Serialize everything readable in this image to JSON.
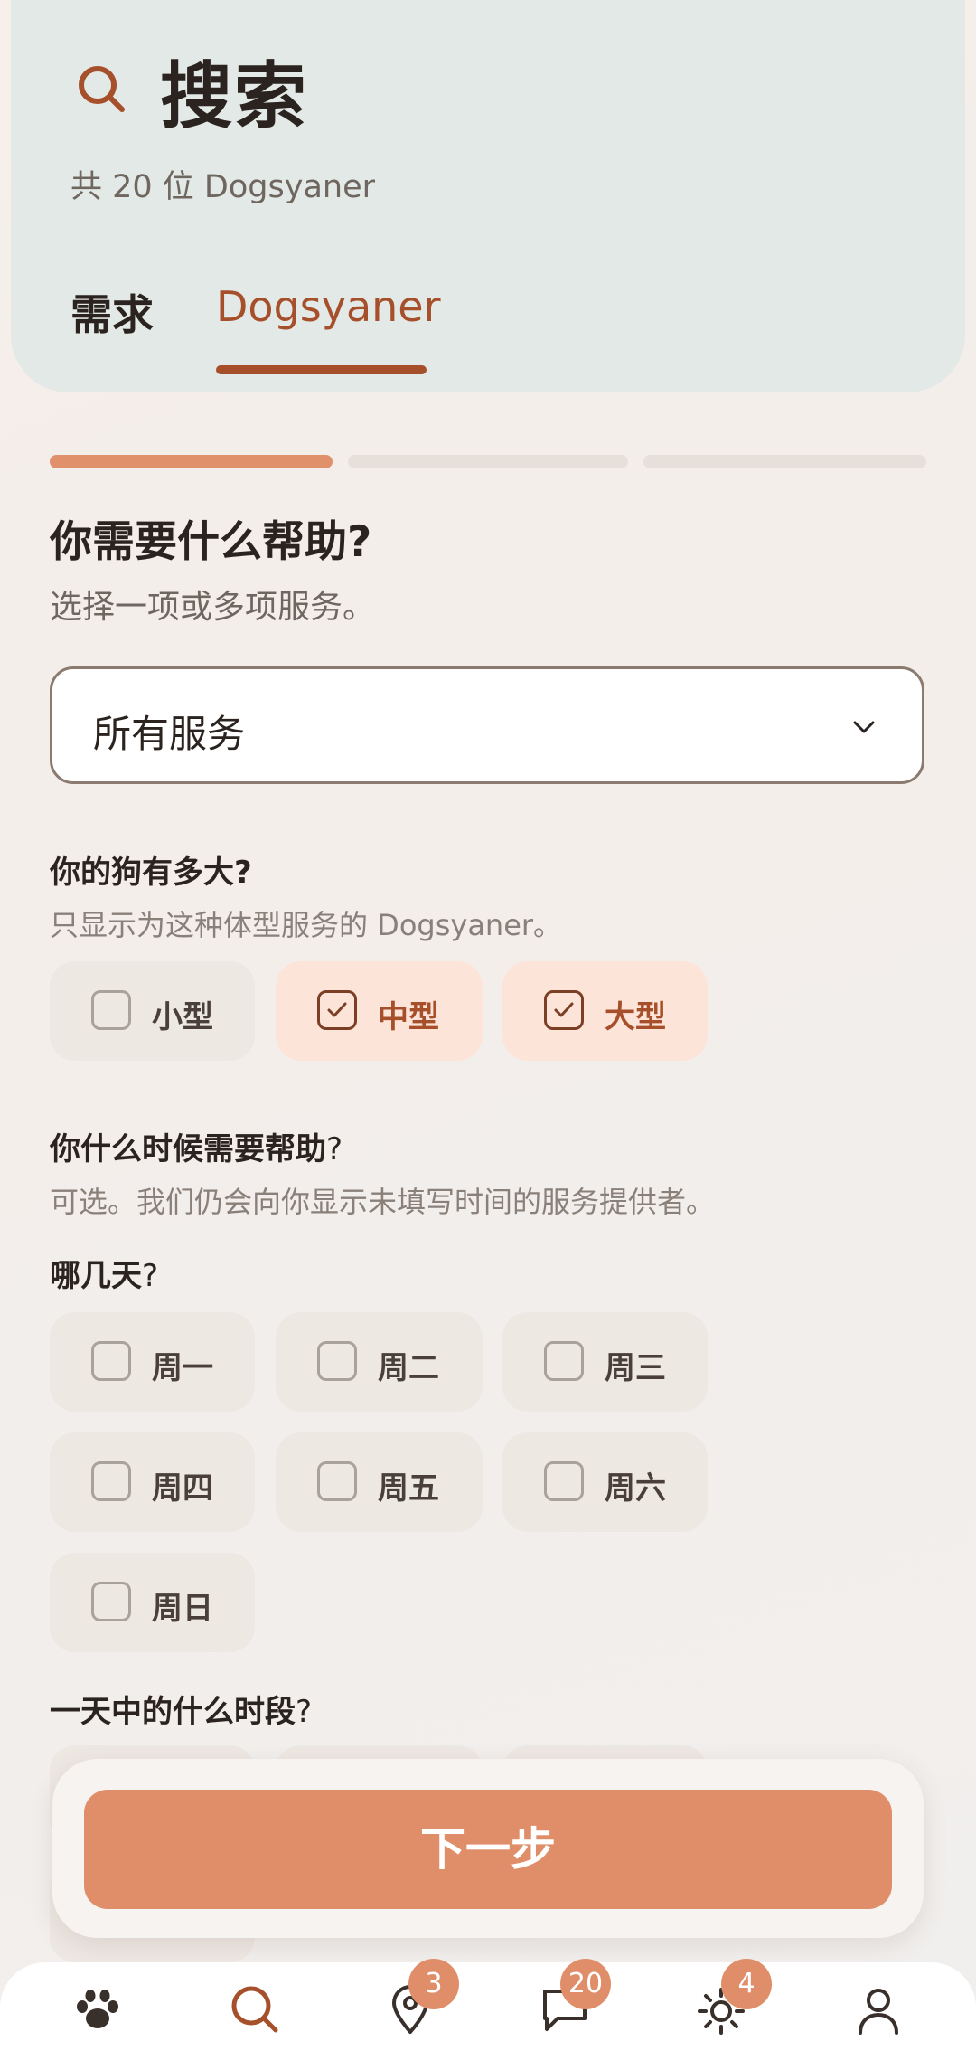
{
  "header": {
    "title": "搜索",
    "subtitle": "共 20 位 Dogsyaner",
    "tabs": [
      {
        "label": "需求",
        "active": false
      },
      {
        "label": "Dogsyaner",
        "active": true
      }
    ]
  },
  "progress": {
    "current_step": 1,
    "total_steps": 3
  },
  "service": {
    "question": "你需要什么帮助?",
    "hint": "选择一项或多项服务。",
    "selected": "所有服务"
  },
  "size": {
    "question": "你的狗有多大?",
    "hint": "只显示为这种体型服务的 Dogsyaner。",
    "options": [
      {
        "label": "小型",
        "checked": false
      },
      {
        "label": "中型",
        "checked": true
      },
      {
        "label": "大型",
        "checked": true
      }
    ]
  },
  "time": {
    "question": "你什么时候需要帮助",
    "qmark": "?",
    "hint": "可选。我们仍会向你显示未填写时间的服务提供者。",
    "days_label": "哪几天",
    "days": [
      {
        "label": "周一",
        "checked": false
      },
      {
        "label": "周二",
        "checked": false
      },
      {
        "label": "周三",
        "checked": false
      },
      {
        "label": "周四",
        "checked": false
      },
      {
        "label": "周五",
        "checked": false
      },
      {
        "label": "周六",
        "checked": false
      },
      {
        "label": "周日",
        "checked": false
      }
    ],
    "period_label": "一天中的什么时段"
  },
  "next_button": "下一步",
  "bottom_nav": {
    "items": [
      {
        "icon": "paw-icon"
      },
      {
        "icon": "search-icon"
      },
      {
        "icon": "location-pin-icon",
        "badge": "3"
      },
      {
        "icon": "chat-bubble-icon",
        "badge": "20"
      },
      {
        "icon": "sun-icon",
        "badge": "4"
      },
      {
        "icon": "user-icon"
      }
    ]
  },
  "colors": {
    "accent": "#e08e69",
    "accent_dark": "#a64f2b",
    "header_bg": "#e3e9e6",
    "chip_selected_bg": "#fde4d9",
    "chip_bg": "#eee8e3"
  }
}
